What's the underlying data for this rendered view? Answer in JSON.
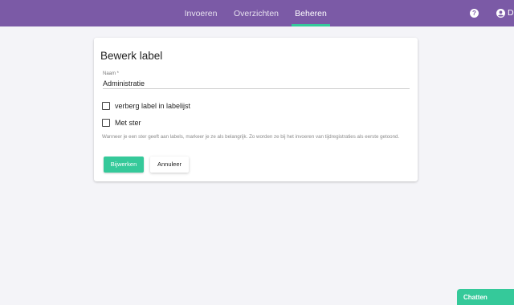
{
  "nav": {
    "tabs": [
      {
        "label": "Invoeren",
        "active": false
      },
      {
        "label": "Overzichten",
        "active": false
      },
      {
        "label": "Beheren",
        "active": true
      }
    ],
    "help_icon": "question-circle-icon",
    "user_icon": "user-circle-icon",
    "user_initial": "D"
  },
  "form": {
    "title": "Bewerk label",
    "name_label": "Naam *",
    "name_value": "Administratie",
    "hide_label": "verberg label in labelijst",
    "hide_checked": false,
    "star_label": "Met ster",
    "star_checked": false,
    "help_text": "Wanneer je een ster geeft aan labels, markeer je ze als belangrijk. Zo worden ze bij het invoeren van tijdregistraties als eerste getoond.",
    "submit_label": "Bijwerken",
    "cancel_label": "Annuleer"
  },
  "chat": {
    "label": "Chatten"
  },
  "colors": {
    "header": "#7b5aa6",
    "accent": "#35c99a",
    "background": "#f4f4f8"
  }
}
